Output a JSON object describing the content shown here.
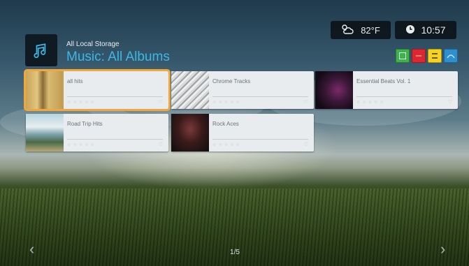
{
  "header": {
    "source": "All Local Storage",
    "title": "Music: All Albums",
    "icon": "music-note-icon"
  },
  "status": {
    "temperature": "82°F",
    "time": "10:57",
    "weather_icon": "weather-icon",
    "clock_icon": "clock-icon"
  },
  "color_buttons": [
    {
      "color": "#39b54a",
      "icon": "b-icon"
    },
    {
      "color": "#e0262e",
      "icon": "red-icon"
    },
    {
      "color": "#f7d21e",
      "icon": "menu-icon"
    },
    {
      "color": "#2e8fd0",
      "icon": "wave-icon"
    }
  ],
  "albums": [
    {
      "title": "all hits",
      "rating": "☆☆☆☆☆",
      "selected": true
    },
    {
      "title": "Chrome Tracks",
      "rating": "☆☆☆☆☆",
      "selected": false
    },
    {
      "title": "Essential Beats Vol. 1",
      "rating": "☆☆☆☆☆",
      "selected": false
    },
    {
      "title": "Road Trip Hits",
      "rating": "☆☆☆☆☆",
      "selected": false
    },
    {
      "title": "Rock Aces",
      "rating": "☆☆☆☆☆",
      "selected": false
    }
  ],
  "pager": "1/5",
  "nav": {
    "prev": "‹",
    "next": "›"
  }
}
